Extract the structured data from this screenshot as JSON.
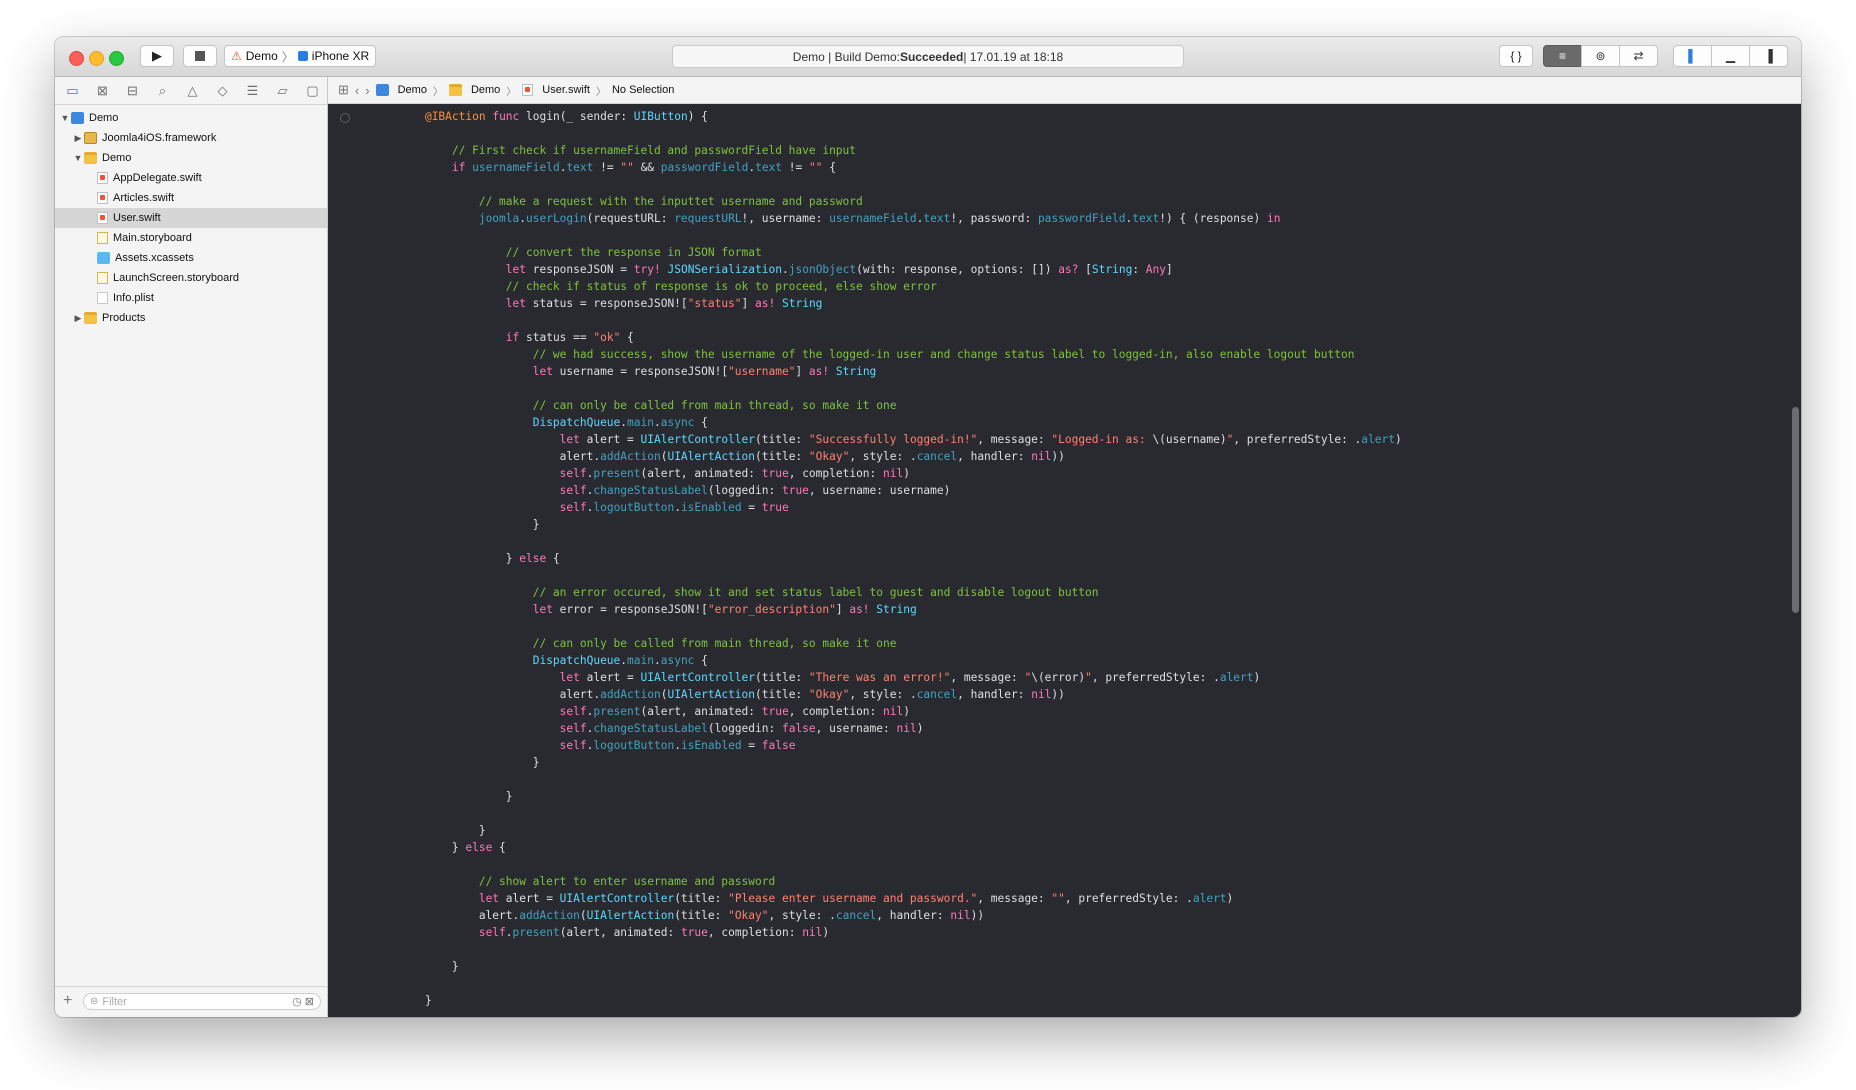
{
  "toolbar": {
    "scheme_project": "Demo",
    "scheme_device": "iPhone XR",
    "activity_prefix": "Demo | Build Demo: ",
    "activity_status": "Succeeded",
    "activity_suffix": " | 17.01.19 at 18:18",
    "editor_buttons": [
      "{ }",
      "≡",
      "⊚",
      "⇄"
    ],
    "view_buttons": [
      "▌",
      "▁",
      "▐"
    ]
  },
  "navigator": {
    "tree": [
      {
        "label": "Demo",
        "indent": 0,
        "disclosure": "▼",
        "icon": "project"
      },
      {
        "label": "Joomla4iOS.framework",
        "indent": 1,
        "disclosure": "▶",
        "icon": "framework"
      },
      {
        "label": "Demo",
        "indent": 1,
        "disclosure": "▼",
        "icon": "folder"
      },
      {
        "label": "AppDelegate.swift",
        "indent": 2,
        "disclosure": "",
        "icon": "swift"
      },
      {
        "label": "Articles.swift",
        "indent": 2,
        "disclosure": "",
        "icon": "swift"
      },
      {
        "label": "User.swift",
        "indent": 2,
        "disclosure": "",
        "icon": "swift",
        "selected": true
      },
      {
        "label": "Main.storyboard",
        "indent": 2,
        "disclosure": "",
        "icon": "storyboard"
      },
      {
        "label": "Assets.xcassets",
        "indent": 2,
        "disclosure": "",
        "icon": "assets"
      },
      {
        "label": "LaunchScreen.storyboard",
        "indent": 2,
        "disclosure": "",
        "icon": "storyboard"
      },
      {
        "label": "Info.plist",
        "indent": 2,
        "disclosure": "",
        "icon": "plist"
      },
      {
        "label": "Products",
        "indent": 1,
        "disclosure": "▶",
        "icon": "folder"
      }
    ],
    "filter_placeholder": "Filter"
  },
  "jumpbar": {
    "crumbs": [
      "Demo",
      "Demo",
      "User.swift",
      "No Selection"
    ]
  },
  "code_lines": [
    [
      [
        "",
        "    "
      ],
      [
        "at",
        "@IBAction"
      ],
      [
        "",
        " "
      ],
      [
        "kw",
        "func"
      ],
      [
        "",
        " login(_ sender: "
      ],
      [
        "ty",
        "UIButton"
      ],
      [
        "",
        ") {"
      ]
    ],
    [],
    [
      [
        "",
        "        "
      ],
      [
        "cm",
        "// First check if usernameField and passwordField have input"
      ]
    ],
    [
      [
        "",
        "        "
      ],
      [
        "kw",
        "if"
      ],
      [
        "",
        " "
      ],
      [
        "fn",
        "usernameField"
      ],
      [
        "",
        "."
      ],
      [
        "fn",
        "text"
      ],
      [
        "",
        " != "
      ],
      [
        "st",
        "\"\""
      ],
      [
        "",
        " && "
      ],
      [
        "fn",
        "passwordField"
      ],
      [
        "",
        "."
      ],
      [
        "fn",
        "text"
      ],
      [
        "",
        " != "
      ],
      [
        "st",
        "\"\""
      ],
      [
        "",
        " {"
      ]
    ],
    [],
    [
      [
        "",
        "            "
      ],
      [
        "cm",
        "// make a request with the inputtet username and password"
      ]
    ],
    [
      [
        "",
        "            "
      ],
      [
        "fn",
        "joomla"
      ],
      [
        "",
        "."
      ],
      [
        "fn",
        "userLogin"
      ],
      [
        "",
        "(requestURL: "
      ],
      [
        "fn",
        "requestURL"
      ],
      [
        "",
        "!, username: "
      ],
      [
        "fn",
        "usernameField"
      ],
      [
        "",
        "."
      ],
      [
        "fn",
        "text"
      ],
      [
        "",
        "!, password: "
      ],
      [
        "fn",
        "passwordField"
      ],
      [
        "",
        "."
      ],
      [
        "fn",
        "text"
      ],
      [
        "",
        "!) { (response) "
      ],
      [
        "kw",
        "in"
      ]
    ],
    [],
    [
      [
        "",
        "                "
      ],
      [
        "cm",
        "// convert the response in JSON format"
      ]
    ],
    [
      [
        "",
        "                "
      ],
      [
        "kw",
        "let"
      ],
      [
        "",
        " responseJSON = "
      ],
      [
        "kw",
        "try!"
      ],
      [
        "",
        " "
      ],
      [
        "ty",
        "JSONSerialization"
      ],
      [
        "",
        "."
      ],
      [
        "fn",
        "jsonObject"
      ],
      [
        "",
        "(with: response, options: []) "
      ],
      [
        "kw",
        "as?"
      ],
      [
        "",
        " ["
      ],
      [
        "ty",
        "String"
      ],
      [
        "",
        ": "
      ],
      [
        "kw",
        "Any"
      ],
      [
        "",
        "]"
      ]
    ],
    [
      [
        "",
        "                "
      ],
      [
        "cm",
        "// check if status of response is ok to proceed, else show error"
      ]
    ],
    [
      [
        "",
        "                "
      ],
      [
        "kw",
        "let"
      ],
      [
        "",
        " status = responseJSON!["
      ],
      [
        "st",
        "\"status\""
      ],
      [
        "",
        "] "
      ],
      [
        "kw",
        "as!"
      ],
      [
        "",
        " "
      ],
      [
        "ty",
        "String"
      ]
    ],
    [],
    [
      [
        "",
        "                "
      ],
      [
        "kw",
        "if"
      ],
      [
        "",
        " status == "
      ],
      [
        "st",
        "\"ok\""
      ],
      [
        "",
        " {"
      ]
    ],
    [
      [
        "",
        "                    "
      ],
      [
        "cm",
        "// we had success, show the username of the logged-in user and change status label to logged-in, also enable logout button"
      ]
    ],
    [
      [
        "",
        "                    "
      ],
      [
        "kw",
        "let"
      ],
      [
        "",
        " username = responseJSON!["
      ],
      [
        "st",
        "\"username\""
      ],
      [
        "",
        "] "
      ],
      [
        "kw",
        "as!"
      ],
      [
        "",
        " "
      ],
      [
        "ty",
        "String"
      ]
    ],
    [],
    [
      [
        "",
        "                    "
      ],
      [
        "cm",
        "// can only be called from main thread, so make it one"
      ]
    ],
    [
      [
        "",
        "                    "
      ],
      [
        "ty",
        "DispatchQueue"
      ],
      [
        "",
        "."
      ],
      [
        "fn",
        "main"
      ],
      [
        "",
        "."
      ],
      [
        "fn",
        "async"
      ],
      [
        "",
        " {"
      ]
    ],
    [
      [
        "",
        "                        "
      ],
      [
        "kw",
        "let"
      ],
      [
        "",
        " alert = "
      ],
      [
        "ty",
        "UIAlertController"
      ],
      [
        "",
        "(title: "
      ],
      [
        "st",
        "\"Successfully logged-in!\""
      ],
      [
        "",
        ", message: "
      ],
      [
        "st",
        "\"Logged-in as: "
      ],
      [
        "",
        "\\("
      ],
      [
        "",
        "username"
      ],
      [
        "",
        ")"
      ],
      [
        "st",
        "\""
      ],
      [
        "",
        ", preferredStyle: ."
      ],
      [
        "fn",
        "alert"
      ],
      [
        "",
        ")"
      ]
    ],
    [
      [
        "",
        "                        alert."
      ],
      [
        "fn",
        "addAction"
      ],
      [
        "",
        "("
      ],
      [
        "ty",
        "UIAlertAction"
      ],
      [
        "",
        "(title: "
      ],
      [
        "st",
        "\"Okay\""
      ],
      [
        "",
        ", style: ."
      ],
      [
        "fn",
        "cancel"
      ],
      [
        "",
        ", handler: "
      ],
      [
        "kw",
        "nil"
      ],
      [
        "",
        "))"
      ]
    ],
    [
      [
        "",
        "                        "
      ],
      [
        "kw",
        "self"
      ],
      [
        "",
        "."
      ],
      [
        "fn",
        "present"
      ],
      [
        "",
        "(alert, animated: "
      ],
      [
        "kw",
        "true"
      ],
      [
        "",
        ", completion: "
      ],
      [
        "kw",
        "nil"
      ],
      [
        "",
        ")"
      ]
    ],
    [
      [
        "",
        "                        "
      ],
      [
        "kw",
        "self"
      ],
      [
        "",
        "."
      ],
      [
        "fn",
        "changeStatusLabel"
      ],
      [
        "",
        "(loggedin: "
      ],
      [
        "kw",
        "true"
      ],
      [
        "",
        ", username: username)"
      ]
    ],
    [
      [
        "",
        "                        "
      ],
      [
        "kw",
        "self"
      ],
      [
        "",
        "."
      ],
      [
        "fn",
        "logoutButton"
      ],
      [
        "",
        "."
      ],
      [
        "fn",
        "isEnabled"
      ],
      [
        "",
        " = "
      ],
      [
        "kw",
        "true"
      ]
    ],
    [
      [
        "",
        "                    }"
      ]
    ],
    [],
    [
      [
        "",
        "                } "
      ],
      [
        "kw",
        "else"
      ],
      [
        "",
        " {"
      ]
    ],
    [],
    [
      [
        "",
        "                    "
      ],
      [
        "cm",
        "// an error occured, show it and set status label to guest and disable logout button"
      ]
    ],
    [
      [
        "",
        "                    "
      ],
      [
        "kw",
        "let"
      ],
      [
        "",
        " error = responseJSON!["
      ],
      [
        "st",
        "\"error_description\""
      ],
      [
        "",
        "] "
      ],
      [
        "kw",
        "as!"
      ],
      [
        "",
        " "
      ],
      [
        "ty",
        "String"
      ]
    ],
    [],
    [
      [
        "",
        "                    "
      ],
      [
        "cm",
        "// can only be called from main thread, so make it one"
      ]
    ],
    [
      [
        "",
        "                    "
      ],
      [
        "ty",
        "DispatchQueue"
      ],
      [
        "",
        "."
      ],
      [
        "fn",
        "main"
      ],
      [
        "",
        "."
      ],
      [
        "fn",
        "async"
      ],
      [
        "",
        " {"
      ]
    ],
    [
      [
        "",
        "                        "
      ],
      [
        "kw",
        "let"
      ],
      [
        "",
        " alert = "
      ],
      [
        "ty",
        "UIAlertController"
      ],
      [
        "",
        "(title: "
      ],
      [
        "st",
        "\"There was an error!\""
      ],
      [
        "",
        ", message: "
      ],
      [
        "st",
        "\""
      ],
      [
        "",
        "\\(error)"
      ],
      [
        "st",
        "\""
      ],
      [
        "",
        ", preferredStyle: ."
      ],
      [
        "fn",
        "alert"
      ],
      [
        "",
        ")"
      ]
    ],
    [
      [
        "",
        "                        alert."
      ],
      [
        "fn",
        "addAction"
      ],
      [
        "",
        "("
      ],
      [
        "ty",
        "UIAlertAction"
      ],
      [
        "",
        "(title: "
      ],
      [
        "st",
        "\"Okay\""
      ],
      [
        "",
        ", style: ."
      ],
      [
        "fn",
        "cancel"
      ],
      [
        "",
        ", handler: "
      ],
      [
        "kw",
        "nil"
      ],
      [
        "",
        "))"
      ]
    ],
    [
      [
        "",
        "                        "
      ],
      [
        "kw",
        "self"
      ],
      [
        "",
        "."
      ],
      [
        "fn",
        "present"
      ],
      [
        "",
        "(alert, animated: "
      ],
      [
        "kw",
        "true"
      ],
      [
        "",
        ", completion: "
      ],
      [
        "kw",
        "nil"
      ],
      [
        "",
        ")"
      ]
    ],
    [
      [
        "",
        "                        "
      ],
      [
        "kw",
        "self"
      ],
      [
        "",
        "."
      ],
      [
        "fn",
        "changeStatusLabel"
      ],
      [
        "",
        "(loggedin: "
      ],
      [
        "kw",
        "false"
      ],
      [
        "",
        ", username: "
      ],
      [
        "kw",
        "nil"
      ],
      [
        "",
        ")"
      ]
    ],
    [
      [
        "",
        "                        "
      ],
      [
        "kw",
        "self"
      ],
      [
        "",
        "."
      ],
      [
        "fn",
        "logoutButton"
      ],
      [
        "",
        "."
      ],
      [
        "fn",
        "isEnabled"
      ],
      [
        "",
        " = "
      ],
      [
        "kw",
        "false"
      ]
    ],
    [
      [
        "",
        "                    }"
      ]
    ],
    [],
    [
      [
        "",
        "                }"
      ]
    ],
    [],
    [
      [
        "",
        "            }"
      ]
    ],
    [
      [
        "",
        "        } "
      ],
      [
        "kw",
        "else"
      ],
      [
        "",
        " {"
      ]
    ],
    [],
    [
      [
        "",
        "            "
      ],
      [
        "cm",
        "// show alert to enter username and password"
      ]
    ],
    [
      [
        "",
        "            "
      ],
      [
        "kw",
        "let"
      ],
      [
        "",
        " alert = "
      ],
      [
        "ty",
        "UIAlertController"
      ],
      [
        "",
        "(title: "
      ],
      [
        "st",
        "\"Please enter username and password.\""
      ],
      [
        "",
        ", message: "
      ],
      [
        "st",
        "\"\""
      ],
      [
        "",
        ", preferredStyle: ."
      ],
      [
        "fn",
        "alert"
      ],
      [
        "",
        ")"
      ]
    ],
    [
      [
        "",
        "            alert."
      ],
      [
        "fn",
        "addAction"
      ],
      [
        "",
        "("
      ],
      [
        "ty",
        "UIAlertAction"
      ],
      [
        "",
        "(title: "
      ],
      [
        "st",
        "\"Okay\""
      ],
      [
        "",
        ", style: ."
      ],
      [
        "fn",
        "cancel"
      ],
      [
        "",
        ", handler: "
      ],
      [
        "kw",
        "nil"
      ],
      [
        "",
        "))"
      ]
    ],
    [
      [
        "",
        "            "
      ],
      [
        "kw",
        "self"
      ],
      [
        "",
        "."
      ],
      [
        "fn",
        "present"
      ],
      [
        "",
        "(alert, animated: "
      ],
      [
        "kw",
        "true"
      ],
      [
        "",
        ", completion: "
      ],
      [
        "kw",
        "nil"
      ],
      [
        "",
        ")"
      ]
    ],
    [],
    [
      [
        "",
        "        }"
      ]
    ],
    [],
    [
      [
        "",
        "    }"
      ]
    ]
  ],
  "colors": {
    "editor_background": "#292a30",
    "keyword": "#ff7ab2",
    "comment": "#7ec23e",
    "type": "#5dd8ff",
    "function": "#41a1c0",
    "string": "#ff8170",
    "attribute": "#fd8f3f",
    "plain": "#dfdfe0"
  }
}
